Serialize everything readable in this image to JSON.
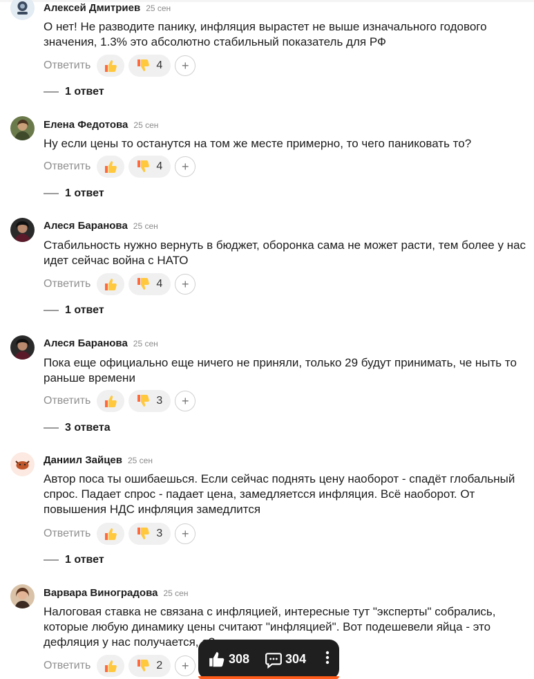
{
  "comments": [
    {
      "author": "Алексей Дмитриев",
      "date": "25 сен",
      "text": "О нет! Не разводите панику, инфляция вырастет не выше изначального годового значения, 1.3% это абсолютно стабильный показатель для РФ",
      "reply_label": "Ответить",
      "dislikes": "4",
      "replies": "1 ответ"
    },
    {
      "author": "Елена Федотова",
      "date": "25 сен",
      "text": "Ну если цены то останутся на том же месте примерно, то чего паниковать то?",
      "reply_label": "Ответить",
      "dislikes": "4",
      "replies": "1 ответ"
    },
    {
      "author": "Алеся Баранова",
      "date": "25 сен",
      "text": "Стабильность нужно вернуть в бюджет, оборонка сама не может расти, тем более у нас идет сейчас война с НАТО",
      "reply_label": "Ответить",
      "dislikes": "4",
      "replies": "1 ответ"
    },
    {
      "author": "Алеся Баранова",
      "date": "25 сен",
      "text": "Пока еще официально еще ничего не приняли, только 29 будут принимать, че ныть то раньше времени",
      "reply_label": "Ответить",
      "dislikes": "3",
      "replies": "3 ответа"
    },
    {
      "author": "Даниил Зайцев",
      "date": "25 сен",
      "text": "Автор поса ты ошибаешься. Если сейчас поднять цену наоборот - спадёт глобальный спрос. Падает спрос - падает цена, замедляетсся инфляция. Всё наоборот. От повышения НДС инфляция замедлится",
      "reply_label": "Ответить",
      "dislikes": "3",
      "replies": "1 ответ"
    },
    {
      "author": "Варвара Виноградова",
      "date": "25 сен",
      "text": "Налоговая ставка не связана с инфляцией, интересные тут \"эксперты\" собрались, которые любую динамику цены считают \"инфляцией\". Вот подешевели яйца - это дефляция у нас получается, а?",
      "reply_label": "Ответить",
      "dislikes": "2"
    }
  ],
  "add_reaction_symbol": "+",
  "floating_bar": {
    "likes": "308",
    "comments": "304"
  },
  "colors": {
    "accent": "#ff5b1a",
    "reaction_bg": "#f0f0f0",
    "emoji_yellow": "#ffc83d",
    "emoji_red": "#ff6a3d"
  }
}
